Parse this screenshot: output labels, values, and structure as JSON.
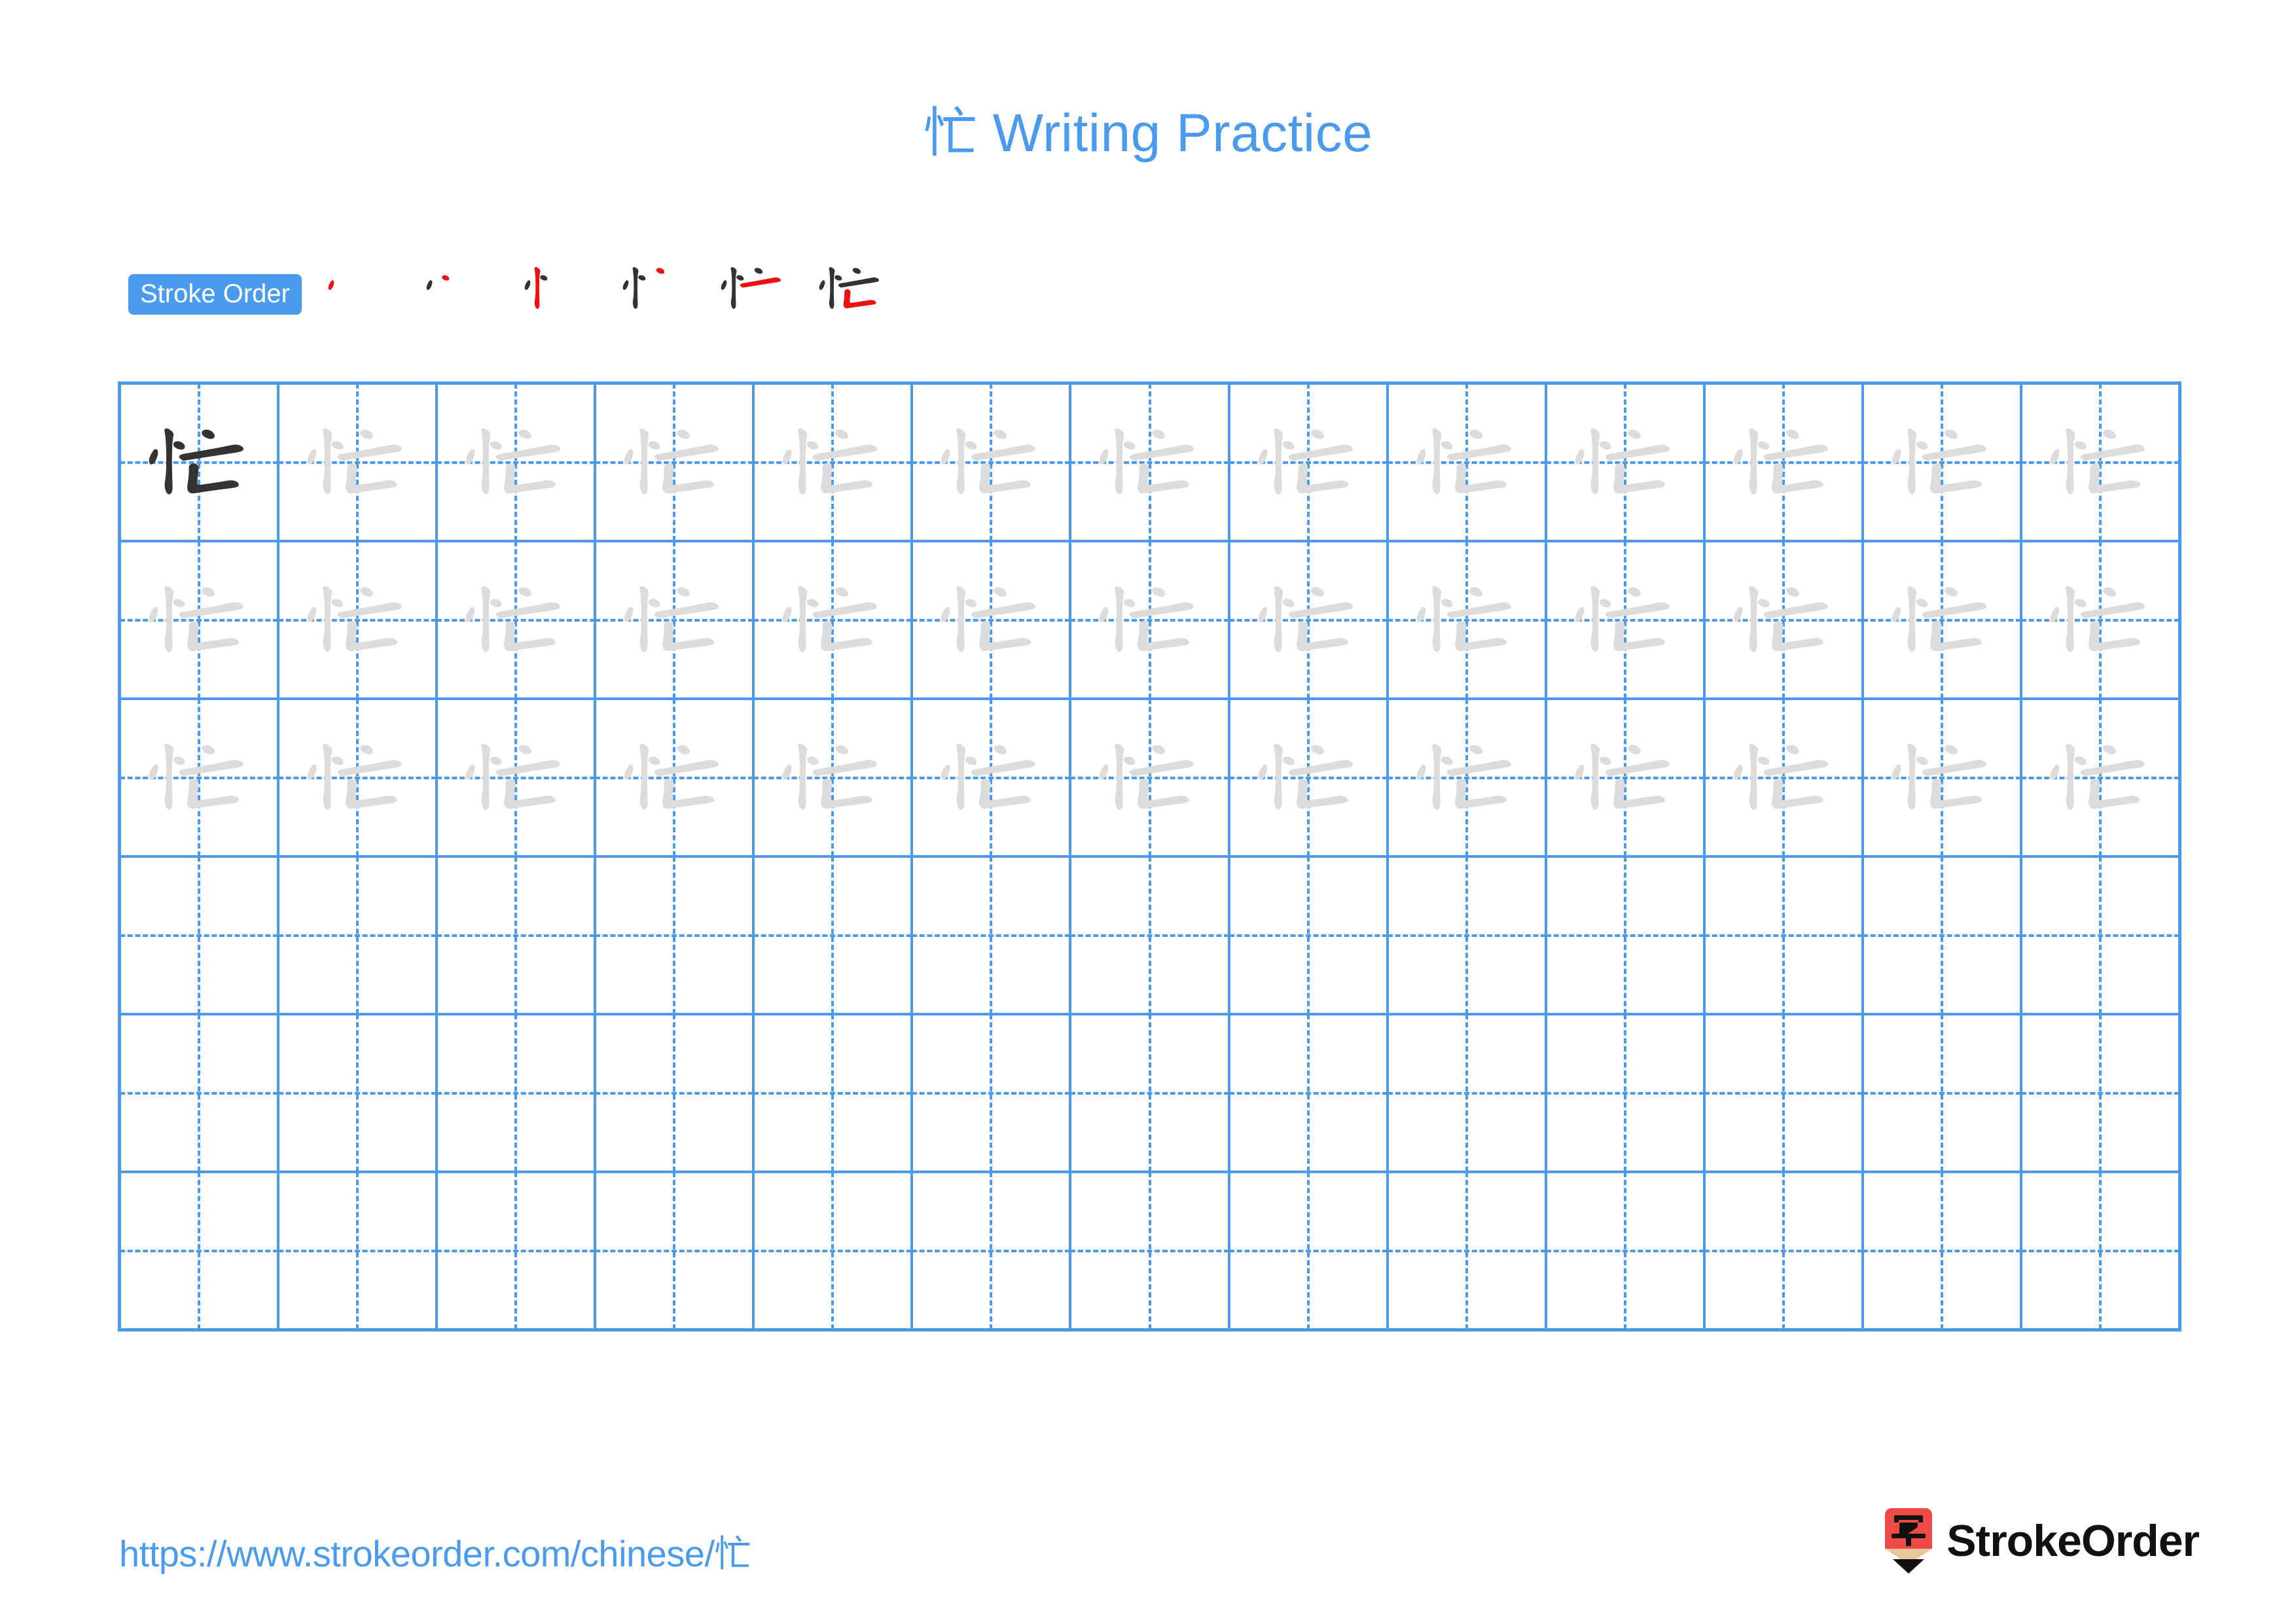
{
  "document": {
    "character": "忙",
    "title_text": "忙 Writing Practice",
    "title_prefix": "忙",
    "title_suffix": " Writing Practice"
  },
  "theme": {
    "accent_blue": "#4a9bf0",
    "stroke_dark": "#333333",
    "stroke_light": "#dcdcdc",
    "stroke_new_red": "#ee1111",
    "logo_red": "#f04a47",
    "logo_wood": "#e8c79c"
  },
  "stroke_order": {
    "badge_label": "Stroke Order",
    "total_strokes": 6,
    "steps": [
      {
        "index": 1,
        "strokes_shown": 1,
        "new_stroke_index": 1
      },
      {
        "index": 2,
        "strokes_shown": 2,
        "new_stroke_index": 2
      },
      {
        "index": 3,
        "strokes_shown": 3,
        "new_stroke_index": 3
      },
      {
        "index": 4,
        "strokes_shown": 4,
        "new_stroke_index": 4
      },
      {
        "index": 5,
        "strokes_shown": 5,
        "new_stroke_index": 5
      },
      {
        "index": 6,
        "strokes_shown": 6,
        "new_stroke_index": 6
      }
    ]
  },
  "grid": {
    "columns": 13,
    "rows": 6,
    "cells": [
      [
        "dark",
        "light",
        "light",
        "light",
        "light",
        "light",
        "light",
        "light",
        "light",
        "light",
        "light",
        "light",
        "light"
      ],
      [
        "light",
        "light",
        "light",
        "light",
        "light",
        "light",
        "light",
        "light",
        "light",
        "light",
        "light",
        "light",
        "light"
      ],
      [
        "light",
        "light",
        "light",
        "light",
        "light",
        "light",
        "light",
        "light",
        "light",
        "light",
        "light",
        "light",
        "light"
      ],
      [
        "empty",
        "empty",
        "empty",
        "empty",
        "empty",
        "empty",
        "empty",
        "empty",
        "empty",
        "empty",
        "empty",
        "empty",
        "empty"
      ],
      [
        "empty",
        "empty",
        "empty",
        "empty",
        "empty",
        "empty",
        "empty",
        "empty",
        "empty",
        "empty",
        "empty",
        "empty",
        "empty"
      ],
      [
        "empty",
        "empty",
        "empty",
        "empty",
        "empty",
        "empty",
        "empty",
        "empty",
        "empty",
        "empty",
        "empty",
        "empty",
        "empty"
      ]
    ]
  },
  "footer": {
    "url_text": "https://www.strokeorder.com/chinese/忙",
    "url_prefix": "https://www.strokeorder.com/chinese/",
    "url_character": "忙",
    "brand_name": "StrokeOrder",
    "logo_character": "字"
  }
}
